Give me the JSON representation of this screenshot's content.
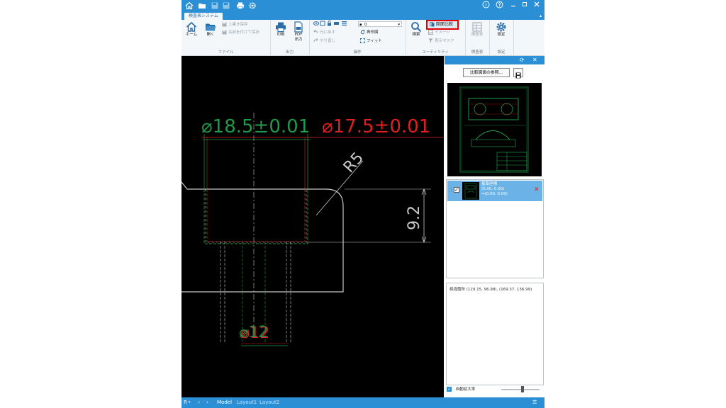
{
  "app": {
    "tab_label": "検査表システム"
  },
  "ribbon": {
    "file": {
      "label": "ファイル",
      "home": "ホーム",
      "open": "開く",
      "overwrite_save": "上書き保存",
      "save_as": "名前を付けて保存"
    },
    "output": {
      "label": "出力",
      "print": "印刷",
      "pdf_line1": "PDF",
      "pdf_line2": "出力"
    },
    "operation": {
      "label": "操作",
      "undo": "元に戻す",
      "redo": "やり直し",
      "layer_value": "0",
      "redraw": "再作図",
      "fit": "フィット"
    },
    "utility": {
      "label": "ユーティリティ",
      "search": "検索",
      "compare": "図面比較",
      "image": "イメージ",
      "display_mask": "表示マスク"
    },
    "inspection": {
      "label": "検査表",
      "button": "検査表"
    },
    "settings": {
      "label": "設定",
      "button": "設定"
    }
  },
  "drawing": {
    "dim_green": "⌀18.5±0.01",
    "dim_red": "⌀17.5±0.01",
    "radius": "R5",
    "height": "9.2",
    "dim_bottom": "⌀12",
    "line_white": "#c8c8c8",
    "line_green": "#1f9a4a",
    "line_red": "#e02020"
  },
  "panel": {
    "reference_button": "比較図面の参照...",
    "list_item": {
      "title": "基準座標",
      "coord1": "(0.00, 0.00)",
      "coord2": "⇒(0.00, 0.00)",
      "checked": true
    },
    "message": "相違箇所 (129.15, 96.98), (169.37, 136.99)",
    "auto_zoom_label": "自動拡大率",
    "auto_zoom_checked": true,
    "zoom_level": 0.55
  },
  "statusbar": {
    "tabs": [
      "Model",
      "Layout1",
      "Layout2"
    ],
    "active_tab": "Model",
    "unit": "R"
  },
  "colors": {
    "accent": "#2b8fd6",
    "highlight": "#e00000",
    "selection": "#6bb3e6"
  }
}
